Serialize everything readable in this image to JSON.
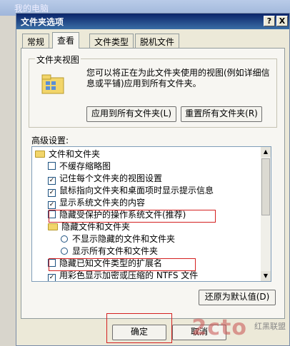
{
  "background": {
    "title": "我的电脑"
  },
  "dialog": {
    "title": "文件夹选项",
    "help_label": "?",
    "close_label": "X"
  },
  "tabs": [
    {
      "label": "常规"
    },
    {
      "label": "查看"
    },
    {
      "label": "文件类型"
    },
    {
      "label": "脱机文件"
    }
  ],
  "folder_view": {
    "group_label": "文件夹视图",
    "description": "您可以将正在为此文件夹使用的视图(例如详细信息或平铺)应用到所有文件夹。",
    "apply_all_label": "应用到所有文件夹(L)",
    "reset_all_label": "重置所有文件夹(R)"
  },
  "advanced": {
    "label": "高级设置:",
    "items": [
      {
        "type": "folder",
        "label": "文件和文件夹"
      },
      {
        "type": "checkbox",
        "checked": false,
        "label": "不缓存缩略图"
      },
      {
        "type": "checkbox",
        "checked": true,
        "label": "记住每个文件夹的视图设置"
      },
      {
        "type": "checkbox",
        "checked": true,
        "label": "鼠标指向文件夹和桌面项时显示提示信息"
      },
      {
        "type": "checkbox",
        "checked": true,
        "label": "显示系统文件夹的内容"
      },
      {
        "type": "checkbox",
        "checked": false,
        "label": "隐藏受保护的操作系统文件(推荐)"
      },
      {
        "type": "folder",
        "label": "隐藏文件和文件夹"
      },
      {
        "type": "radio",
        "checked": false,
        "label": "不显示隐藏的文件和文件夹"
      },
      {
        "type": "radio",
        "checked": false,
        "label": "显示所有文件和文件夹"
      },
      {
        "type": "checkbox",
        "checked": false,
        "label": "隐藏已知文件类型的扩展名"
      },
      {
        "type": "checkbox",
        "checked": true,
        "label": "用彩色显示加密或压缩的 NTFS 文件"
      }
    ],
    "restore_label": "还原为默认值(D)"
  },
  "footer": {
    "ok_label": "确定",
    "cancel_label": "取消"
  },
  "watermark": {
    "text": "2cto",
    "sub": "红黑联盟"
  },
  "colors": {
    "highlight_box": "#d42020",
    "title_bar": "#0a246a"
  }
}
